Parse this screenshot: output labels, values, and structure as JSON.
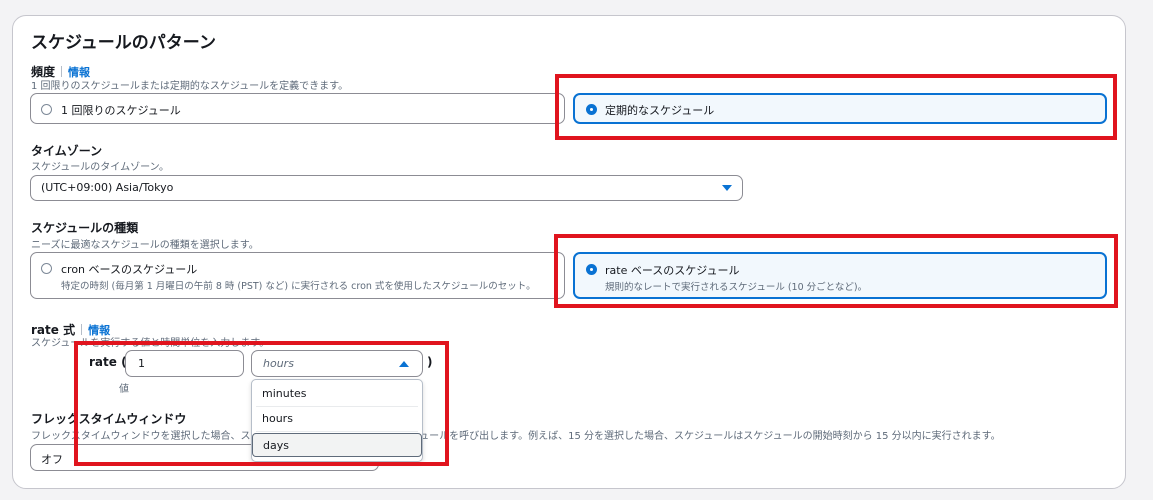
{
  "section": {
    "title": "スケジュールのパターン"
  },
  "frequency": {
    "label": "頻度",
    "info": "情報",
    "description": "1 回限りのスケジュールまたは定期的なスケジュールを定義できます。",
    "options": [
      {
        "label": "1 回限りのスケジュール",
        "selected": false
      },
      {
        "label": "定期的なスケジュール",
        "selected": true
      }
    ]
  },
  "timezone": {
    "label": "タイムゾーン",
    "description": "スケジュールのタイムゾーン。",
    "value": "(UTC+09:00) Asia/Tokyo"
  },
  "schedule_type": {
    "label": "スケジュールの種類",
    "description": "ニーズに最適なスケジュールの種類を選択します。",
    "options": [
      {
        "label": "cron ベースのスケジュール",
        "sub": "特定の時刻 (毎月第 1 月曜日の午前 8 時 (PST) など) に実行される cron 式を使用したスケジュールのセット。",
        "selected": false
      },
      {
        "label": "rate ベースのスケジュール",
        "sub": "規則的なレートで実行されるスケジュール (10 分ごとなど)。",
        "selected": true
      }
    ]
  },
  "rate": {
    "label": "rate 式",
    "info": "情報",
    "description": "スケジュールを実行する値と時間単位を入力します。",
    "prefix": "rate (",
    "suffix": ")",
    "value": "1",
    "value_caption": "値",
    "unit_placeholder": "hours",
    "unit_options": [
      "minutes",
      "hours",
      "days"
    ],
    "highlighted_option": "days"
  },
  "flex": {
    "label": "フレックスタイムウィンドウ",
    "description": "フレックスタイムウィンドウを選択した場合、スケジューラーはその時間枠内でスケジュールを呼び出します。例えば、15 分を選択した場合、スケジュールはスケジュールの開始時刻から 15 分以内に実行されます。",
    "value": "オフ"
  },
  "colors": {
    "accent": "#0972d3",
    "highlight_box": "#e0141e",
    "selected_tile_bg": "#f2f8fd"
  }
}
